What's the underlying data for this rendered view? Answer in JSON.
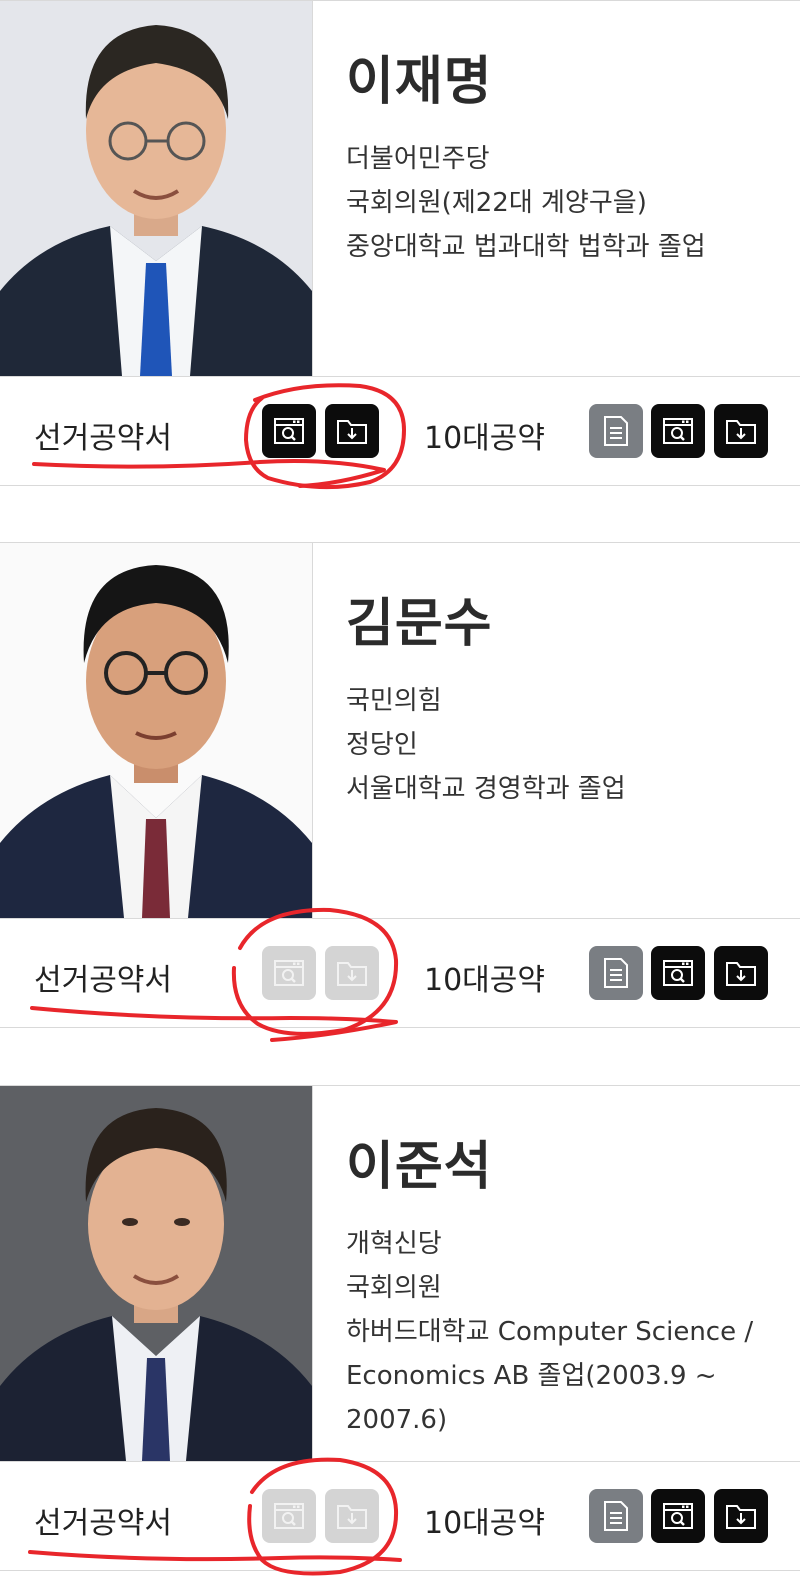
{
  "candidates": [
    {
      "name": "이재명",
      "info": [
        "더불어민주당",
        "국회의원(제22대 계양구을)",
        "중앙대학교 법과대학 법학과 졸업"
      ],
      "pledge_label": "선거공약서",
      "top10_label": "10대공약",
      "pledge_buttons_enabled": true
    },
    {
      "name": "김문수",
      "info": [
        "국민의힘",
        "정당인",
        "서울대학교 경영학과 졸업"
      ],
      "pledge_label": "선거공약서",
      "top10_label": "10대공약",
      "pledge_buttons_enabled": false
    },
    {
      "name": "이준석",
      "info": [
        "개혁신당",
        "국회의원",
        "하버드대학교 Computer Science / Economics AB 졸업(2003.9 ~ 2007.6)"
      ],
      "pledge_label": "선거공약서",
      "top10_label": "10대공약",
      "pledge_buttons_enabled": false
    }
  ],
  "icons": {
    "view": "document-search-icon",
    "download": "folder-download-icon",
    "list": "document-list-icon"
  },
  "colors": {
    "button_active": "#0c0c0c",
    "button_disabled": "#d4d4d4",
    "button_list": "#7a7e83",
    "annotation": "#e8262b"
  }
}
